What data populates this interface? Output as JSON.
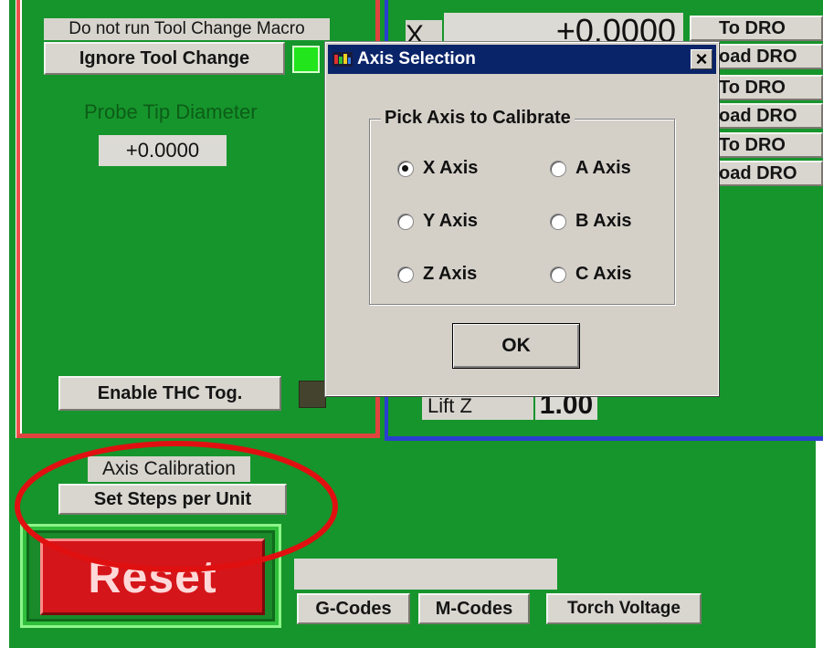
{
  "left_panel": {
    "tool_change_label": "Do not run Tool Change Macro",
    "ignore_tool_change_button": "Ignore Tool Change",
    "probe_tip_label": "Probe Tip Diameter",
    "probe_tip_value": "+0.0000",
    "enable_thc_button": "Enable THC Tog."
  },
  "right_panel": {
    "dro_axis_letter": "X",
    "dro_value": "+0.0000",
    "dro_buttons": [
      "To DRO",
      "oad DRO",
      "To DRO",
      "oad DRO",
      "To DRO",
      "oad DRO"
    ],
    "lift_z_label": "Lift Z",
    "lift_z_value": "1.00"
  },
  "bottom": {
    "axis_calibration_label": "Axis Calibration",
    "set_steps_button": "Set Steps per Unit",
    "reset_button": "Reset",
    "gcodes_button": "G-Codes",
    "mcodes_button": "M-Codes",
    "torch_voltage_button": "Torch Voltage",
    "status_field_value": ""
  },
  "dialog": {
    "title": "Axis Selection",
    "close_glyph": "×",
    "group_label": "Pick Axis to Calibrate",
    "options": [
      "X Axis",
      "A Axis",
      "Y Axis",
      "B Axis",
      "Z Axis",
      "C Axis"
    ],
    "selected": "X Axis",
    "ok_button": "OK"
  },
  "colors": {
    "screen_green": "#16952c",
    "indicator_green": "#22e51c",
    "reset_red": "#d4151a",
    "annotation_red": "#e01010",
    "dialog_title_blue": "#0a246a"
  }
}
